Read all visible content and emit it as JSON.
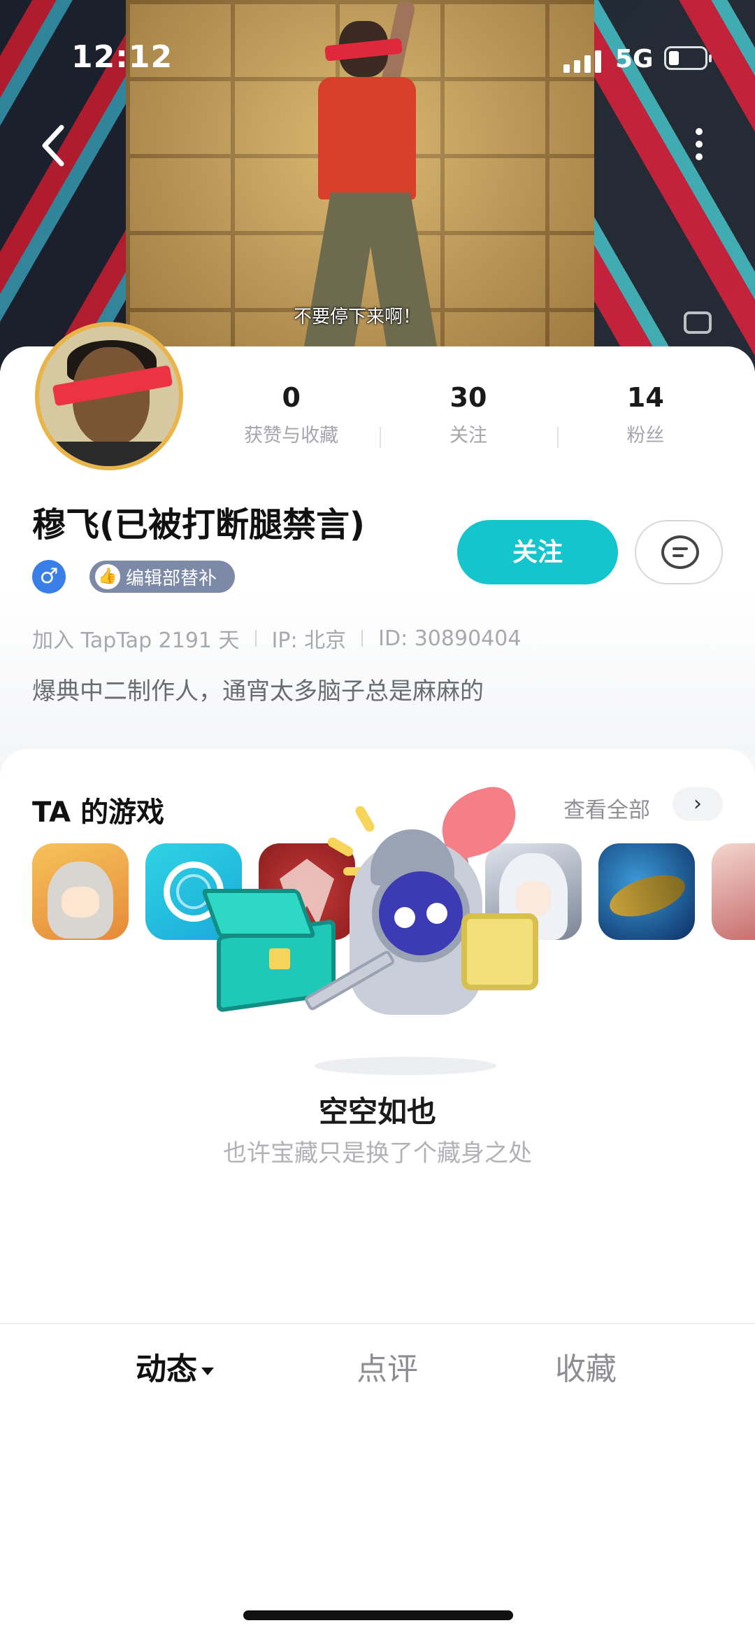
{
  "status_bar": {
    "time": "12:12",
    "network": "5G"
  },
  "banner": {
    "video_subtitle": "不要停下来啊！"
  },
  "profile": {
    "stats": [
      {
        "value": "0",
        "label": "获赞与收藏"
      },
      {
        "value": "30",
        "label": "关注"
      },
      {
        "value": "14",
        "label": "粉丝"
      }
    ],
    "username": "穆飞(已被打断腿禁言)",
    "gender_symbol": "♂",
    "role_badge": "编辑部替补",
    "follow_label": "关注",
    "meta": {
      "joined": "加入 TapTap 2191 天",
      "ip": "IP: 北京",
      "id": "ID: 30890404"
    },
    "bio": "爆典中二制作人，通宵太多脑子总是麻麻的"
  },
  "games": {
    "title": "TA 的游戏",
    "view_all": "查看全部",
    "view_all_arrow": "›"
  },
  "tabs": [
    {
      "label": "动态",
      "active": true
    },
    {
      "label": "点评",
      "active": false
    },
    {
      "label": "收藏",
      "active": false
    }
  ],
  "empty_state": {
    "title": "空空如也",
    "subtitle": "也许宝藏只是换了个藏身之处"
  },
  "colors": {
    "accent": "#15c5ce",
    "badge": "#7d8aa7",
    "gender": "#3a7ee8"
  }
}
